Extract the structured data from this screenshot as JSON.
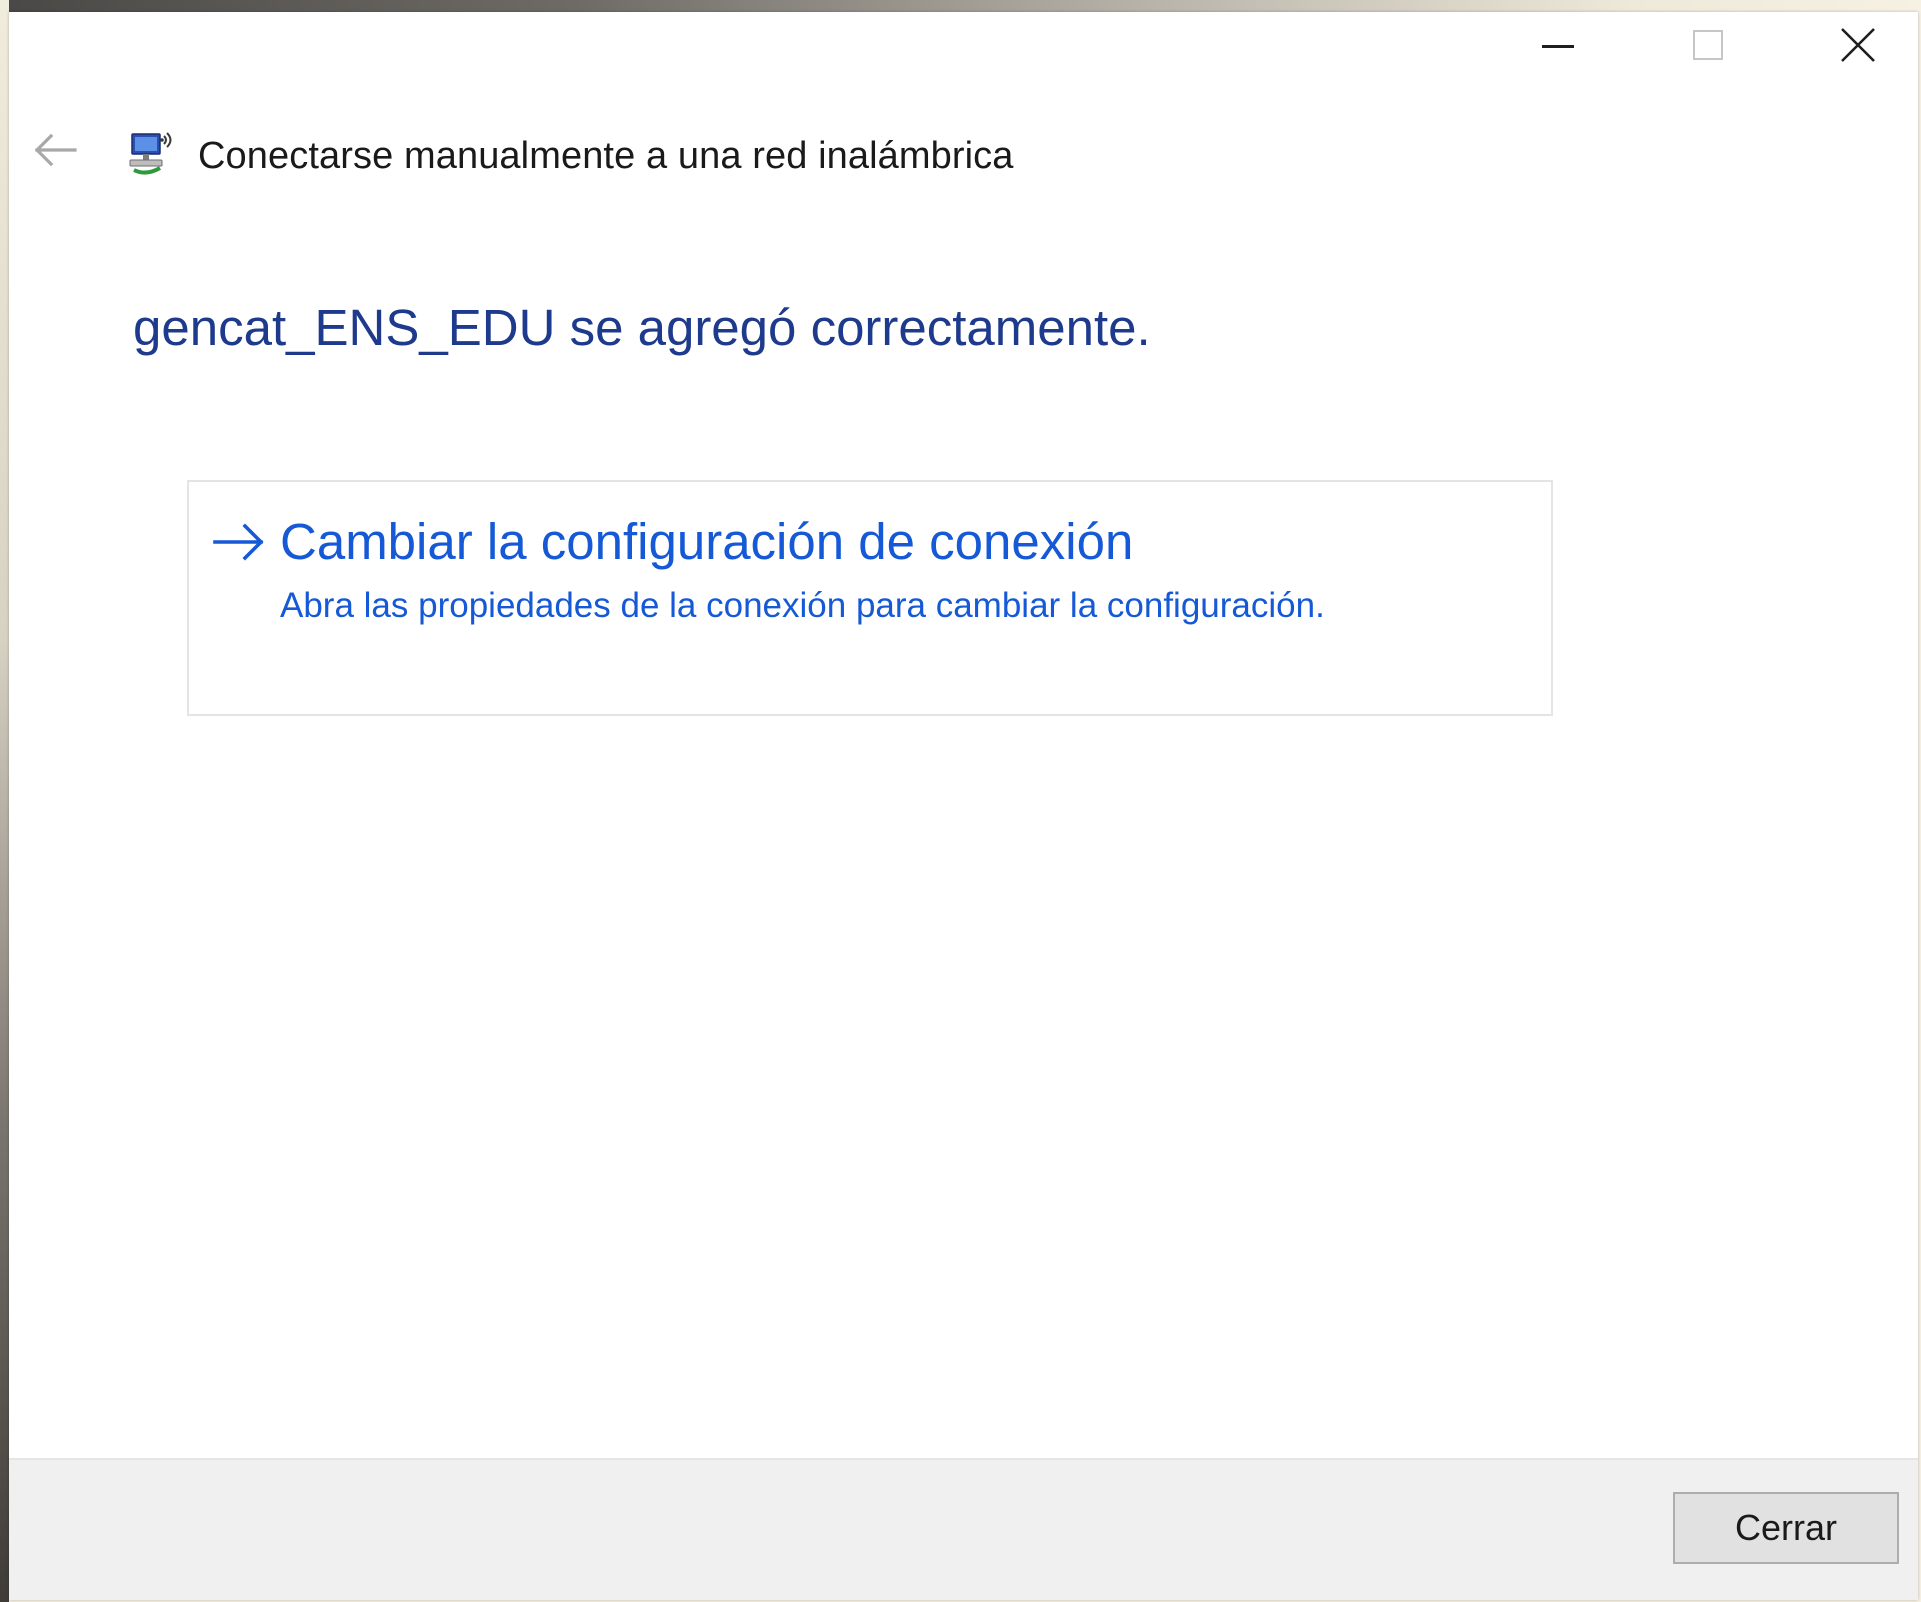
{
  "window": {
    "title": "Conectarse manualmente a una red inalámbrica",
    "caption_buttons": {
      "minimize_icon": "minimize-icon",
      "maximize_icon": "maximize-icon",
      "close_icon": "close-icon"
    },
    "back_icon": "back-arrow-icon",
    "wizard_icon": "network-wizard-icon"
  },
  "main": {
    "heading": "gencat_ENS_EDU se agregó correctamente.",
    "command_link": {
      "icon": "arrow-right-icon",
      "title": "Cambiar la configuración de conexión",
      "description": "Abra las propiedades de la conexión para cambiar la configuración."
    }
  },
  "footer": {
    "close_label": "Cerrar"
  },
  "colors": {
    "heading": "#1e3a8c",
    "link": "#1559d6",
    "footer_bg": "#f0f0f0"
  }
}
